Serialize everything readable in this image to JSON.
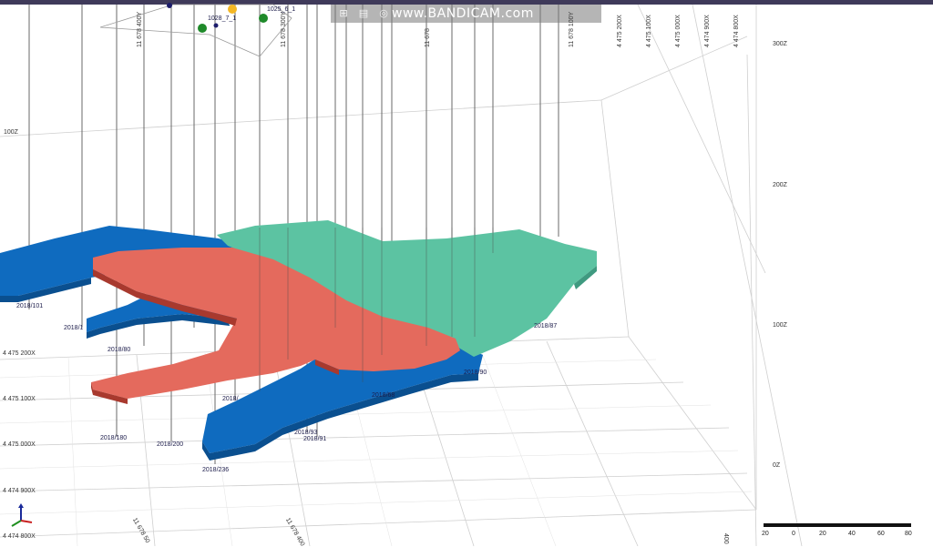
{
  "watermark": "www.BANDICAM.com",
  "toolbar": {
    "icons": [
      "grid-icon",
      "layers-icon",
      "target-icon",
      "camera-icon",
      "view-icon"
    ]
  },
  "top_labels": {
    "collar_a": "1025_6_1",
    "collar_b": "1028_7_1"
  },
  "grid_axes": {
    "top_y": [
      "11 678 400Y",
      "11 678 300Y",
      "11 678",
      "11 678 100Y"
    ],
    "top_x": [
      "4 475 200X",
      "4 475 100X",
      "4 475 000X",
      "4 474 900X",
      "4 474 800X"
    ],
    "left_x": [
      "4 475 200X",
      "4 475 100X",
      "4 475 000X",
      "4 474 900X",
      "4 474 800X"
    ],
    "bottom_y": [
      "11 678 50",
      "11 678 400",
      "400"
    ],
    "z_right": [
      "300Z",
      "200Z",
      "100Z",
      "0Z"
    ],
    "z_left": [
      "100Z"
    ]
  },
  "drillholes": [
    "2018/101",
    "2018/1",
    "2018/80",
    "2018/180",
    "2018/200",
    "2018/236",
    "2018/68",
    "2018/93",
    "2018/91",
    "2018/90",
    "2018/",
    "2018/87"
  ],
  "colors": {
    "blue_body": "#0f6bbf",
    "red_body": "#e46a5d",
    "green_body": "#5cc3a2",
    "grid": "#c8c8c8"
  },
  "scale": {
    "ticks": [
      "20",
      "0",
      "20",
      "40",
      "60",
      "80"
    ]
  }
}
